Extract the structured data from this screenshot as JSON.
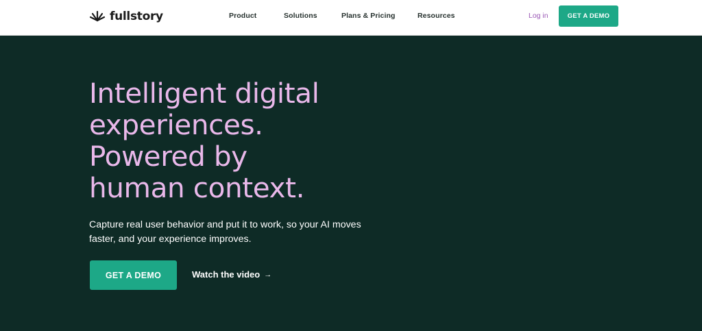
{
  "header": {
    "brand_name": "fullstory",
    "nav": [
      "Product",
      "Solutions",
      "Plans & Pricing",
      "Resources"
    ],
    "login_label": "Log in",
    "demo_label": "GET A DEMO"
  },
  "hero": {
    "headline_lines": [
      "Intelligent digital",
      "experiences.",
      "Powered by",
      "human context."
    ],
    "subtext": "Capture real user behavior and put it to work, so your AI moves faster, and your experience improves.",
    "primary_cta": "GET A DEMO",
    "secondary_cta": "Watch the video",
    "secondary_arrow": "→"
  },
  "colors": {
    "accent": "#1da887",
    "hero_bg": "#0e2b26",
    "headline": "#e9b8ea",
    "login_link": "#9b59b6"
  },
  "icons": {
    "logo": "fullstory-burst-icon",
    "cta_arrow": "arrow-right-icon"
  }
}
